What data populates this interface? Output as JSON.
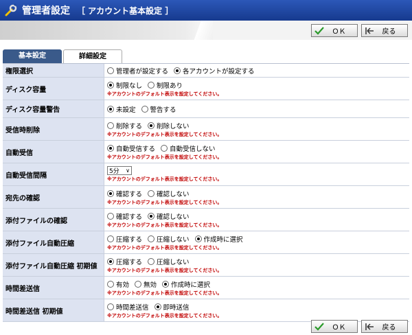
{
  "header": {
    "title": "管理者設定",
    "subtitle": "［ アカウント基本設定 ］",
    "icon": "wrench-icon"
  },
  "toolbar": {
    "ok_label": "ＯＫ",
    "back_label": "戻る"
  },
  "tabs": [
    {
      "label": "基本設定",
      "active": true
    },
    {
      "label": "詳細設定",
      "active": false
    }
  ],
  "default_note": "※アカウントのデフォルト表示を設定してください。",
  "rows": [
    {
      "label": "権限選択",
      "options": [
        "管理者が設定する",
        "各アカウントが設定する"
      ],
      "selected": 1,
      "note": false
    },
    {
      "label": "ディスク容量",
      "options": [
        "制限なし",
        "制限あり"
      ],
      "selected": 0,
      "note": true
    },
    {
      "label": "ディスク容量警告",
      "options": [
        "未設定",
        "警告する"
      ],
      "selected": 0,
      "note": false
    },
    {
      "label": "受信時削除",
      "options": [
        "削除する",
        "削除しない"
      ],
      "selected": 1,
      "note": true
    },
    {
      "label": "自動受信",
      "options": [
        "自動受信する",
        "自動受信しない"
      ],
      "selected": 0,
      "note": true
    },
    {
      "label": "自動受信間隔",
      "select_value": "5分",
      "note": true
    },
    {
      "label": "宛先の確認",
      "options": [
        "確認する",
        "確認しない"
      ],
      "selected": 0,
      "note": true
    },
    {
      "label": "添付ファイルの確認",
      "options": [
        "確認する",
        "確認しない"
      ],
      "selected": 1,
      "note": true
    },
    {
      "label": "添付ファイル自動圧縮",
      "options": [
        "圧縮する",
        "圧縮しない",
        "作成時に選択"
      ],
      "selected": 2,
      "note": true
    },
    {
      "label": "添付ファイル自動圧縮 初期値",
      "options": [
        "圧縮する",
        "圧縮しない"
      ],
      "selected": 0,
      "note": true
    },
    {
      "label": "時間差送信",
      "options": [
        "有効",
        "無効",
        "作成時に選択"
      ],
      "selected": 2,
      "note": true
    },
    {
      "label": "時間差送信 初期値",
      "options": [
        "時間差送信",
        "即時送信"
      ],
      "selected": 1,
      "note": true
    }
  ],
  "colors": {
    "title_bar": "#1f48a0",
    "row_label_bg": "#dde3f1",
    "note_text": "#c00000",
    "tab_active": "#3a5a8a"
  }
}
